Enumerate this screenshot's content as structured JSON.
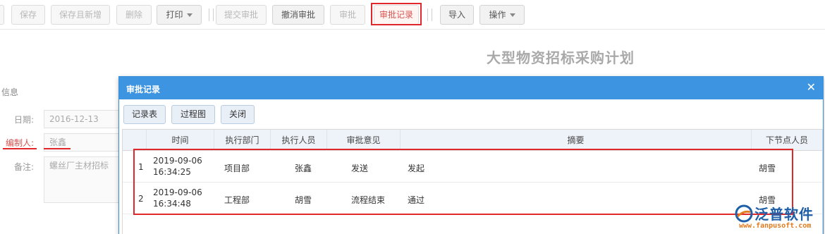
{
  "toolbar": {
    "buttons": [
      {
        "label": "保存"
      },
      {
        "label": "保存且新增"
      },
      {
        "label": "删除"
      },
      {
        "label": "打印"
      },
      {
        "label": "提交审批"
      },
      {
        "label": "撤消审批"
      },
      {
        "label": "审批"
      },
      {
        "label": "审批记录"
      },
      {
        "label": "导入"
      },
      {
        "label": "操作"
      }
    ]
  },
  "document": {
    "title": "大型物资招标采购计划",
    "section_label": "信息",
    "fields": [
      {
        "label": "日期:",
        "value": "2016-12-13"
      },
      {
        "label": "编制人:",
        "value": "张鑫"
      },
      {
        "label": "备注:",
        "value": "螺丝厂主材招标"
      }
    ]
  },
  "dialog": {
    "title": "审批记录",
    "close_icon": "close-icon",
    "buttons": [
      {
        "label": "记录表"
      },
      {
        "label": "过程图"
      },
      {
        "label": "关闭"
      }
    ],
    "table": {
      "columns": [
        "时间",
        "执行部门",
        "执行人员",
        "审批意见",
        "摘要",
        "下节点人员"
      ],
      "rows": [
        {
          "index": "1",
          "date": "2019-09-06",
          "time": "16:34:25",
          "department": "项目部",
          "person": "张鑫",
          "opinion": "发送",
          "summary": "发起",
          "next_person": "胡雪"
        },
        {
          "index": "2",
          "date": "2019-09-06",
          "time": "16:34:48",
          "department": "工程部",
          "person": "胡雪",
          "opinion": "流程结束",
          "summary": "通过",
          "next_person": "胡雪"
        }
      ]
    }
  },
  "watermark": {
    "brand": "泛普软件",
    "url": "www.fanpusoft.com"
  },
  "colors": {
    "dialog_header": "#3d94e0",
    "highlight_red": "#e2272b"
  }
}
